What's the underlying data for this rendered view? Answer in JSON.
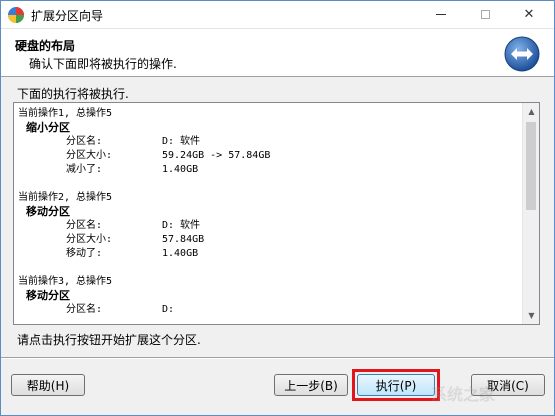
{
  "window": {
    "title": "扩展分区向导"
  },
  "header": {
    "title": "硬盘的布局",
    "subtitle": "确认下面即将被执行的操作."
  },
  "panel": {
    "title": "下面的执行将被执行.",
    "operations": [
      {
        "head": "当前操作1, 总操作5",
        "name": "缩小分区",
        "rows": [
          {
            "k": "分区名:",
            "v": "D: 软件"
          },
          {
            "k": "分区大小:",
            "v": "59.24GB -> 57.84GB"
          },
          {
            "k": "减小了:",
            "v": "1.40GB"
          }
        ]
      },
      {
        "head": "当前操作2, 总操作5",
        "name": "移动分区",
        "rows": [
          {
            "k": "分区名:",
            "v": "D: 软件"
          },
          {
            "k": "分区大小:",
            "v": "57.84GB"
          },
          {
            "k": "移动了:",
            "v": "1.40GB"
          }
        ]
      },
      {
        "head": "当前操作3, 总操作5",
        "name": "移动分区",
        "rows": [
          {
            "k": "分区名:",
            "v": "D:"
          }
        ]
      }
    ]
  },
  "footer": {
    "instruction": "请点击执行按钮开始扩展这个分区."
  },
  "buttons": {
    "help": "帮助(H)",
    "back": "上一步(B)",
    "execute": "执行(P)",
    "cancel": "取消(C)"
  },
  "watermark": "系统之家"
}
